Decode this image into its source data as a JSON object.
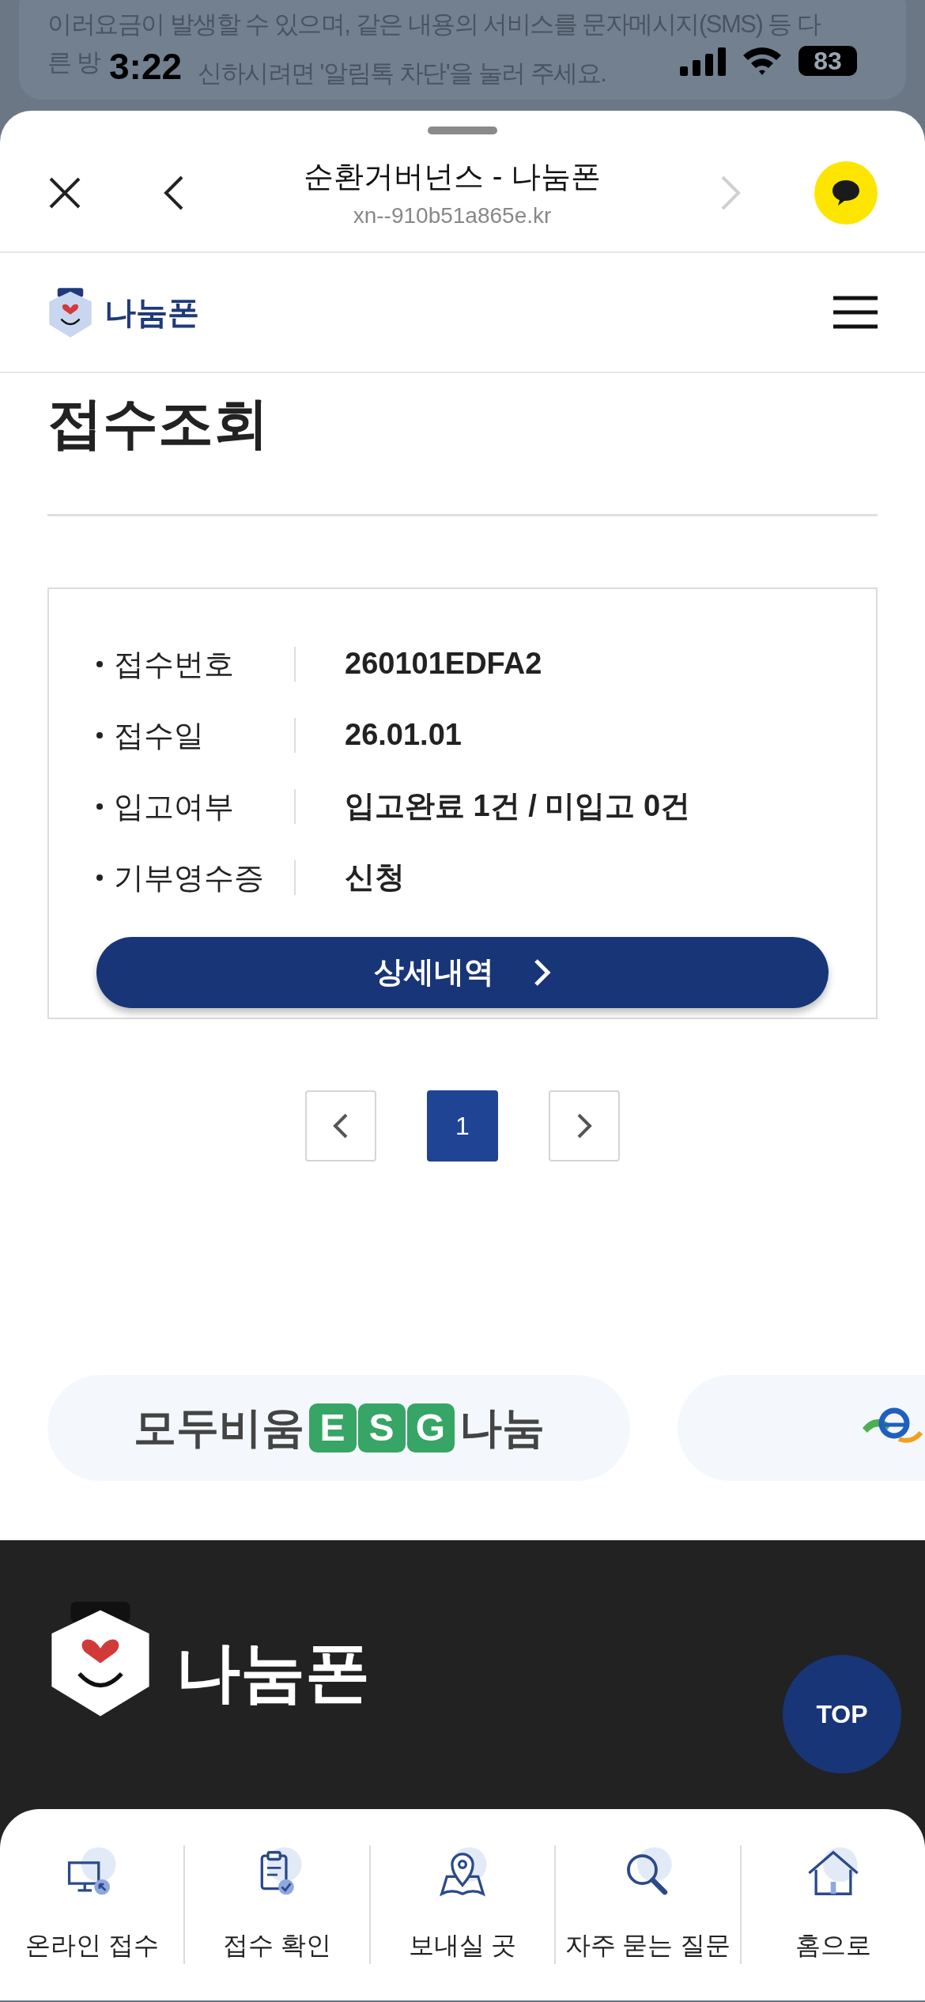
{
  "background_notice": {
    "line_1": "이러요금이 발생할 수 있으며, 같은 내용의 서비스를 문자메시지(SMS) 등 다",
    "line_2_start": "른 방",
    "line_2_end": "신하시려면 '알림톡 차단'을 눌러 주세요."
  },
  "status_bar": {
    "time": "3:22",
    "battery": "83"
  },
  "browser": {
    "title": "순환거버넌스 - 나눔폰",
    "url": "xn--910b51a865e.kr",
    "forward_disabled": true
  },
  "site_header": {
    "logo_text": "나눔폰"
  },
  "page_title": "접수조회",
  "receipt": {
    "rows": [
      {
        "label": "접수번호",
        "value": "260101EDFA2"
      },
      {
        "label": "접수일",
        "value": "26.01.01"
      },
      {
        "label": "입고여부",
        "value": "입고완료 1건 / 미입고 0건"
      },
      {
        "label": "기부영수증",
        "value": "신청"
      }
    ],
    "button": "상세내역"
  },
  "pagination": {
    "pages": [
      {
        "label": "1",
        "selected": true
      }
    ]
  },
  "banners": [
    {
      "kind": "esg",
      "before": "모두비움",
      "letters": [
        "E",
        "S",
        "G"
      ],
      "after": "나눔"
    },
    {
      "kind": "partial"
    }
  ],
  "footer": {
    "logo_text": "나눔폰",
    "top_button": "TOP"
  },
  "bottom_nav": [
    {
      "kind": "monitor",
      "label": "온라인 접수"
    },
    {
      "kind": "clipboard",
      "label": "접수 확인"
    },
    {
      "kind": "map",
      "label": "보내실 곳"
    },
    {
      "kind": "search",
      "label": "자주 묻는 질문"
    },
    {
      "kind": "home",
      "label": "홈으로"
    }
  ]
}
